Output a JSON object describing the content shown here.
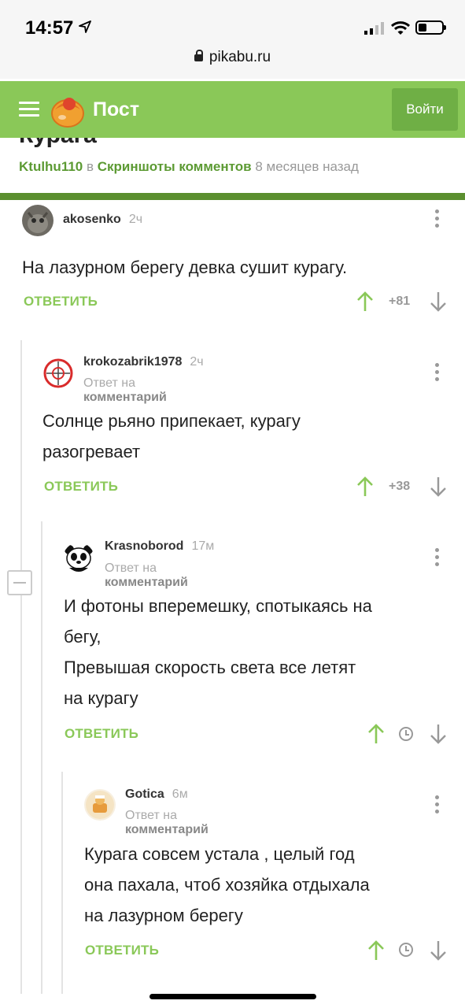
{
  "status": {
    "time": "14:57"
  },
  "browser": {
    "url": "pikabu.ru"
  },
  "header": {
    "title": "Пост",
    "login": "Войти"
  },
  "post": {
    "title": "Курага",
    "author": "Ktulhu110",
    "in": "в",
    "community": "Скриншоты комментов",
    "age": "8 месяцев назад"
  },
  "comments": [
    {
      "user": "akosenko",
      "time": "2ч",
      "reply_label": "",
      "reply_target": "",
      "lines": [
        "На лазурном берегу девка сушит курагу."
      ],
      "action": "ОТВЕТИТЬ",
      "score": "+81"
    },
    {
      "user": "krokozabrik1978",
      "time": "2ч",
      "reply_label": "Ответ на",
      "reply_target": "комментарий",
      "lines": [
        "Солнце рьяно припекает, курагу",
        "разогревает"
      ],
      "action": "ОТВЕТИТЬ",
      "score": "+38"
    },
    {
      "user": "Krasnoborod",
      "time": "17м",
      "reply_label": "Ответ на",
      "reply_target": "комментарий",
      "lines": [
        "И фотоны вперемешку, спотыкаясь на",
        "бегу,",
        "Превышая скорость света все летят",
        "на курагу"
      ],
      "action": "ОТВЕТИТЬ",
      "score": ""
    },
    {
      "user": "Gotica",
      "time": "6м",
      "reply_label": "Ответ на",
      "reply_target": "комментарий",
      "lines": [
        "Курага совсем устала , целый год",
        "она пахала, чтоб хозяйка отдыхала",
        "на лазурном берегу"
      ],
      "action": "ОТВЕТИТЬ",
      "score": ""
    }
  ],
  "colors": {
    "accent": "#8ac858",
    "accent_dark": "#5b8f2f"
  },
  "icons": [
    "location-arrow-icon",
    "signal-icon",
    "wifi-icon",
    "battery-icon",
    "lock-icon",
    "menu-icon",
    "pikabu-logo-icon",
    "more-vert-icon",
    "upvote-arrow-icon",
    "downvote-arrow-icon",
    "clock-icon",
    "collapse-icon"
  ]
}
